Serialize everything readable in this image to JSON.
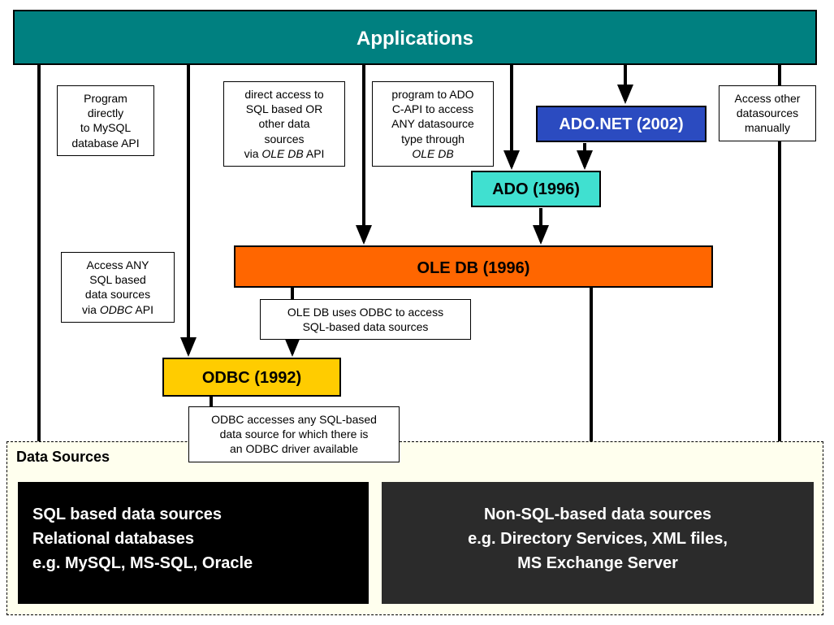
{
  "applications": "Applications",
  "adonet": "ADO.NET (2002)",
  "ado": "ADO (1996)",
  "oledb": "OLE DB (1996)",
  "odbc": "ODBC (1992)",
  "data_sources_label": "Data Sources",
  "sql_sources_line1": "SQL based data sources",
  "sql_sources_line2": "Relational databases",
  "sql_sources_line3": "e.g. MySQL, MS-SQL, Oracle",
  "nonsql_sources_line1": "Non-SQL-based data sources",
  "nonsql_sources_line2": "e.g. Directory Services, XML files,",
  "nonsql_sources_line3": "MS Exchange Server",
  "ann1_line1": "Program",
  "ann1_line2": "directly",
  "ann1_line3": "to MySQL",
  "ann1_line4": "database API",
  "ann2_line1": "direct access to",
  "ann2_line2": "SQL based OR",
  "ann2_line3": "other data",
  "ann2_line4": "sources",
  "ann2_line5a": "via ",
  "ann2_line5b": "OLE DB",
  "ann2_line5c": " API",
  "ann3_line1": "program to ADO",
  "ann3_line2": "C-API to access",
  "ann3_line3": "ANY datasource",
  "ann3_line4": "type through",
  "ann3_line5": "OLE DB",
  "ann4_line1": "Access other",
  "ann4_line2": "datasources",
  "ann4_line3": "manually",
  "ann5_line1": "Access ANY",
  "ann5_line2": "SQL based",
  "ann5_line3": "data sources",
  "ann5_line4a": "via ",
  "ann5_line4b": "ODBC",
  "ann5_line4c": " API",
  "ann6_line1": "OLE DB uses ODBC to access",
  "ann6_line2": "SQL-based data sources",
  "ann7_line1": "ODBC accesses any SQL-based",
  "ann7_line2": "data source for which there is",
  "ann7_line3": "an ODBC driver available"
}
